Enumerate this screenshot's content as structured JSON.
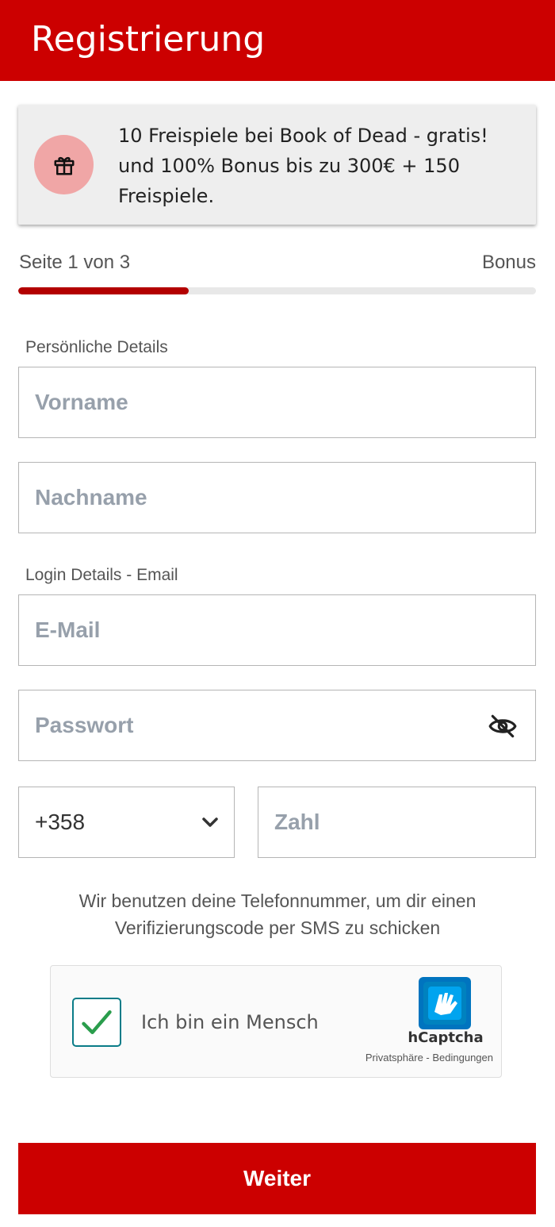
{
  "header": {
    "title": "Registrierung"
  },
  "promo": {
    "icon": "gift-icon",
    "text": "10 Freispiele bei Book of Dead - gratis! und 100% Bonus bis zu 300€ + 150 Freispiele."
  },
  "progress": {
    "step_text": "Seite 1 von 3",
    "next_step": "Bonus",
    "fraction": 0.33
  },
  "sections": {
    "personal": "Persönliche Details",
    "login": "Login Details - Email"
  },
  "fields": {
    "first_name_placeholder": "Vorname",
    "last_name_placeholder": "Nachname",
    "email_placeholder": "E-Mail",
    "password_placeholder": "Passwort",
    "phone_placeholder": "Zahl"
  },
  "country_code": {
    "value": "+358"
  },
  "sms_note": "Wir benutzen deine Telefonnummer, um dir einen Verifizierungscode per SMS zu schicken",
  "captcha": {
    "label": "Ich bin ein Mensch",
    "brand": "hCaptcha",
    "links": "Privatsphäre - Bedingungen",
    "checked": true
  },
  "actions": {
    "next_label": "Weiter"
  },
  "colors": {
    "brand": "#cc0000",
    "progress_fill": "#b30000",
    "captcha_check": "#2a9d4c"
  }
}
